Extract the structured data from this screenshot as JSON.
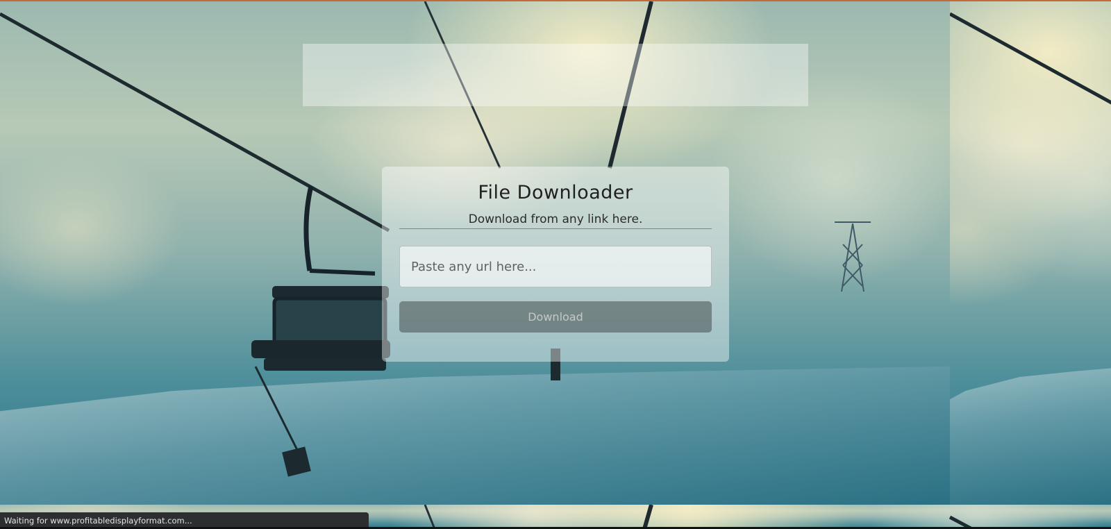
{
  "card": {
    "title": "File Downloader",
    "subtitle": "Download from any link here.",
    "url_placeholder": "Paste any url here...",
    "download_label": "Download"
  },
  "status_bar": {
    "text": "Waiting for www.profitabledisplayformat.com..."
  },
  "colors": {
    "sky": "#b7c9b6",
    "snow_deep": "#2a7285",
    "card_bg": "rgba(255,255,255,0.42)",
    "button_bg": "rgba(70,78,76,0.55)",
    "status_bg": "#2c2e30",
    "top_accent": "#c26a3a"
  }
}
